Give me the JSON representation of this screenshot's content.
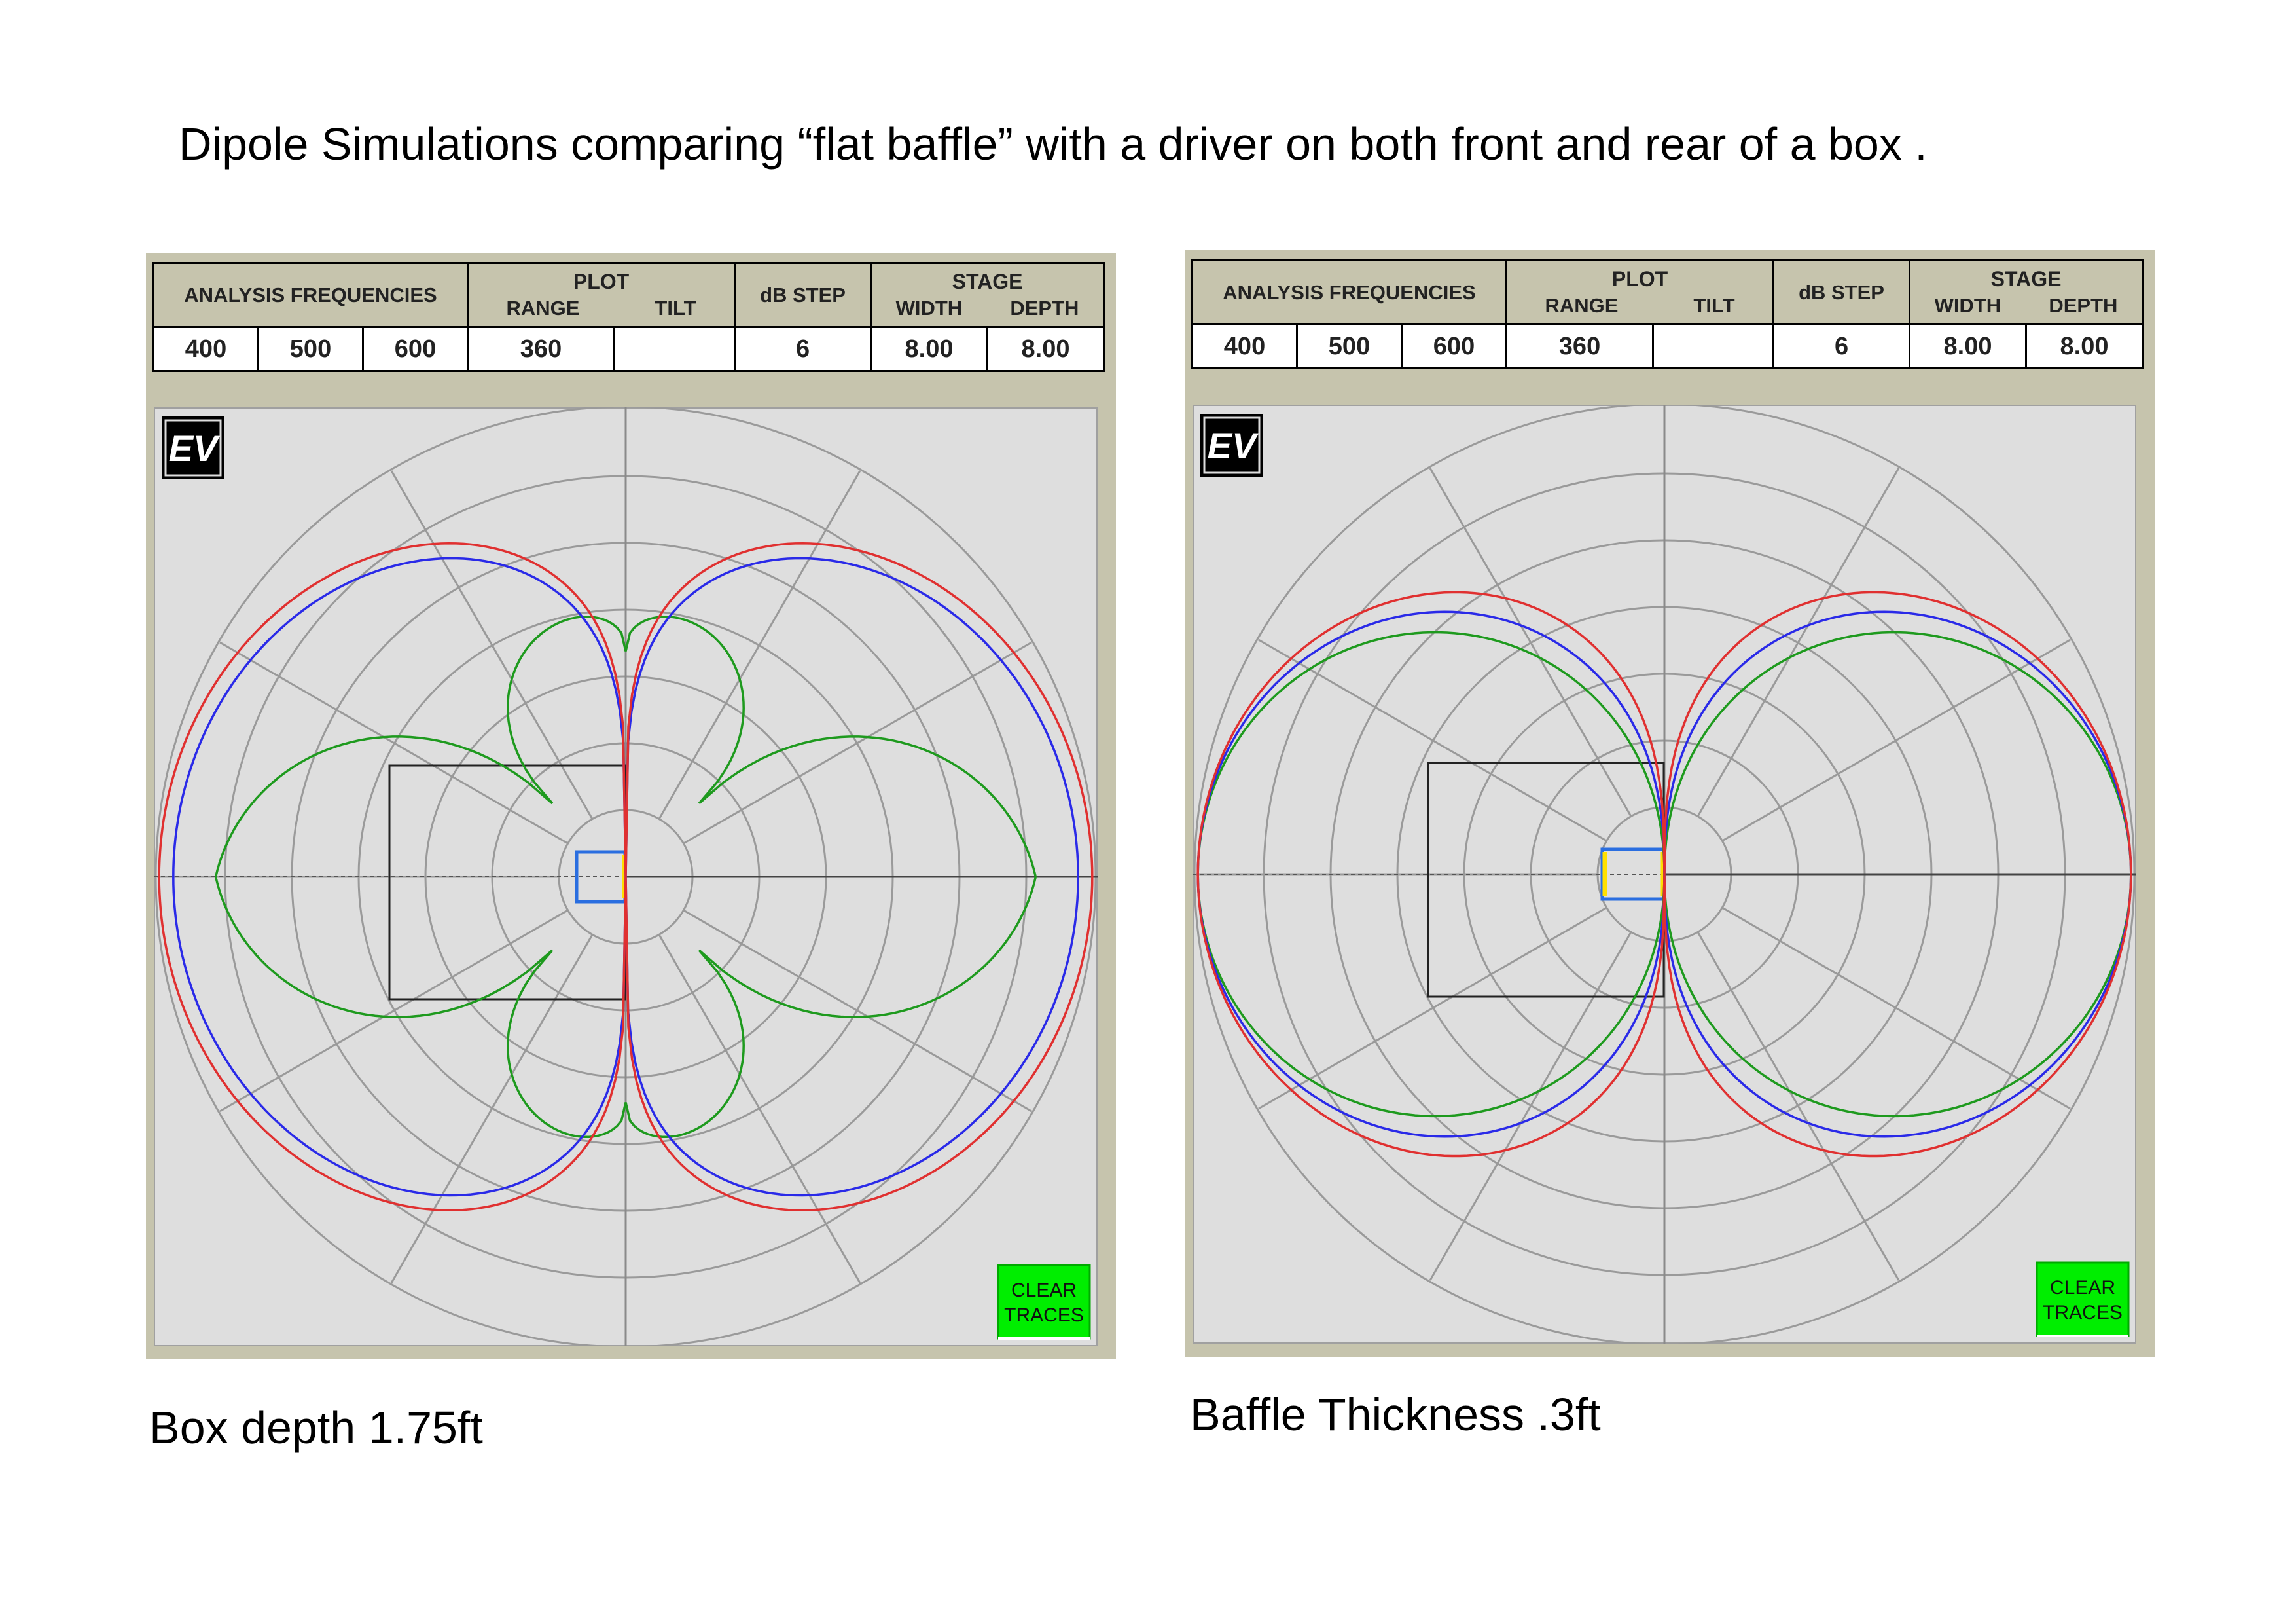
{
  "title": "Dipole Simulations comparing “flat baffle” with a driver on both front and rear of a box .",
  "panels": [
    {
      "id": "left",
      "caption": "Box depth 1.75ft",
      "header": {
        "analysis_frequencies_label": "ANALYSIS FREQUENCIES",
        "plot_label": "PLOT",
        "range_label": "RANGE",
        "tilt_label": "TILT",
        "db_step_label": "dB STEP",
        "stage_label": "STAGE",
        "width_label": "WIDTH",
        "depth_label": "DEPTH"
      },
      "values": {
        "freq1": "400",
        "freq2": "500",
        "freq3": "600",
        "range": "360",
        "tilt": "",
        "db_step": "6",
        "width": "8.00",
        "depth": "8.00"
      },
      "logo": "EV",
      "clear_button": {
        "line1": "CLEAR",
        "line2": "TRACES"
      },
      "colors": {
        "f400": "#e03030",
        "f500": "#2a2ae8",
        "f600": "#1e9a1e",
        "button": "#00ee00",
        "plot_bg": "#dedede"
      }
    },
    {
      "id": "right",
      "caption": "Baffle Thickness  .3ft",
      "header": {
        "analysis_frequencies_label": "ANALYSIS FREQUENCIES",
        "plot_label": "PLOT",
        "range_label": "RANGE",
        "tilt_label": "TILT",
        "db_step_label": "dB STEP",
        "stage_label": "STAGE",
        "width_label": "WIDTH",
        "depth_label": "DEPTH"
      },
      "values": {
        "freq1": "400",
        "freq2": "500",
        "freq3": "600",
        "range": "360",
        "tilt": "",
        "db_step": "6",
        "width": "8.00",
        "depth": "8.00"
      },
      "logo": "EV",
      "clear_button": {
        "line1": "CLEAR",
        "line2": "TRACES"
      },
      "colors": {
        "f400": "#e03030",
        "f500": "#2a2ae8",
        "f600": "#1e9a1e",
        "button": "#00ee00",
        "plot_bg": "#dedede"
      }
    }
  ]
}
